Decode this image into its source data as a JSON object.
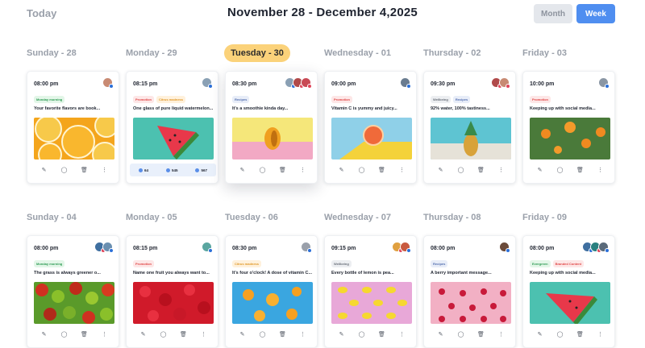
{
  "header": {
    "today_label": "Today",
    "range_label": "November 28 - December 4,2025",
    "view_month": "Month",
    "view_week": "Week"
  },
  "colors": {
    "accent": "#4f8ef0",
    "active_day": "#fbd27a"
  },
  "weeks": [
    {
      "days": [
        {
          "label": "Sunday - 28",
          "active": false,
          "card": {
            "time": "08:00 pm",
            "avatars": [
              {
                "bg": "#c88a73",
                "net": "#2b6fd8"
              }
            ],
            "tags": [
              {
                "text": "Monday morning",
                "bg": "#e3f6e8",
                "fg": "#2e9b54"
              }
            ],
            "text": "Your favorite flavors are book...",
            "image": "orange",
            "stats": null
          }
        },
        {
          "label": "Monday - 29",
          "active": false,
          "card": {
            "time": "08:15 pm",
            "avatars": [
              {
                "bg": "#8aa0b4",
                "net": "#2b6fd8"
              }
            ],
            "tags": [
              {
                "text": "Promotion",
                "bg": "#fde7e7",
                "fg": "#e04848"
              },
              {
                "text": "Citrus madness",
                "bg": "#fff1dc",
                "fg": "#e09a2c"
              }
            ],
            "text": "One glass of pure liquid watermelon...",
            "image": "watermelon",
            "stats": {
              "likes": "64",
              "shares": "545",
              "comments": "567"
            }
          }
        },
        {
          "label": "Tuesday - 30",
          "active": true,
          "card": {
            "time": "08:30 pm",
            "avatars": [
              {
                "bg": "#8aa0b4",
                "net": "#2b6fd8"
              },
              {
                "bg": "#b04a4a",
                "net": "#e0455a"
              },
              {
                "bg": "#c84a55",
                "net": "#e0455a"
              }
            ],
            "tags": [
              {
                "text": "Recipes",
                "bg": "#e8edf8",
                "fg": "#5570b0"
              }
            ],
            "text": "It's a smoothie kinda day...",
            "image": "mango",
            "stats": null
          }
        },
        {
          "label": "Wednesday - 01",
          "active": false,
          "card": {
            "time": "09:00 pm",
            "avatars": [
              {
                "bg": "#6a7c90",
                "net": "#2b6fd8"
              }
            ],
            "tags": [
              {
                "text": "Promotion",
                "bg": "#fde7e7",
                "fg": "#e04848"
              }
            ],
            "text": "Vitamin C is yummy and juicy...",
            "image": "grapefruit",
            "stats": null
          }
        },
        {
          "label": "Thursday - 02",
          "active": false,
          "card": {
            "time": "09:30 pm",
            "avatars": [
              {
                "bg": "#b04a4a",
                "net": "#e0455a"
              },
              {
                "bg": "#c88a73",
                "net": "#e0455a"
              }
            ],
            "tags": [
              {
                "text": "Wellbeing",
                "bg": "#eceef1",
                "fg": "#6a707a"
              },
              {
                "text": "Recipes",
                "bg": "#e8edf8",
                "fg": "#5570b0"
              }
            ],
            "text": "92% water, 100% tastiness...",
            "image": "pineapple",
            "stats": null
          }
        },
        {
          "label": "Friday - 03",
          "active": false,
          "card": {
            "time": "10:00 pm",
            "avatars": [
              {
                "bg": "#8a96a4",
                "net": "#2b6fd8"
              }
            ],
            "tags": [
              {
                "text": "Promotion",
                "bg": "#fde7e7",
                "fg": "#e04848"
              }
            ],
            "text": "Keeping up with social media...",
            "image": "orangetree",
            "stats": null
          }
        }
      ]
    },
    {
      "days": [
        {
          "label": "Sunday - 04",
          "active": false,
          "card": {
            "time": "08:00 pm",
            "avatars": [
              {
                "bg": "#3f6fa0",
                "net": "#e0455a"
              },
              {
                "bg": "#6a8fb0",
                "net": "#2b6fd8"
              }
            ],
            "tags": [
              {
                "text": "Monday morning",
                "bg": "#e3f6e8",
                "fg": "#2e9b54"
              }
            ],
            "text": "The grass is always greener o...",
            "image": "apples",
            "stats": null
          }
        },
        {
          "label": "Monday - 05",
          "active": false,
          "card": {
            "time": "08:15 pm",
            "avatars": [
              {
                "bg": "#5aa6a0",
                "net": "#2b6fd8"
              }
            ],
            "tags": [
              {
                "text": "Promotion",
                "bg": "#fde7e7",
                "fg": "#e04848"
              }
            ],
            "text": "Name one fruit you always want to...",
            "image": "strawberries",
            "stats": null
          }
        },
        {
          "label": "Tuesday - 06",
          "active": false,
          "card": {
            "time": "08:30 pm",
            "avatars": [
              {
                "bg": "#9aa0aa",
                "net": "#2b6fd8"
              }
            ],
            "tags": [
              {
                "text": "Citrus madness",
                "bg": "#fff1dc",
                "fg": "#e09a2c"
              }
            ],
            "text": "It's four o'clock! A dose of vitamin C...",
            "image": "oranges-blue",
            "stats": null
          }
        },
        {
          "label": "Wednesday - 07",
          "active": false,
          "card": {
            "time": "09:15 pm",
            "avatars": [
              {
                "bg": "#e0a040",
                "net": "#e0455a"
              },
              {
                "bg": "#c85a40",
                "net": "#2b6fd8"
              }
            ],
            "tags": [
              {
                "text": "Wellbeing",
                "bg": "#eceef1",
                "fg": "#6a707a"
              }
            ],
            "text": "Every bottle of lemon is pea...",
            "image": "lemons",
            "stats": null
          }
        },
        {
          "label": "Thursday - 08",
          "active": false,
          "card": {
            "time": "08:00 pm",
            "avatars": [
              {
                "bg": "#6a4a3a",
                "net": "#2b6fd8"
              }
            ],
            "tags": [
              {
                "text": "Recipes",
                "bg": "#e8edf8",
                "fg": "#5570b0"
              }
            ],
            "text": "A berry important message...",
            "image": "berries",
            "stats": null
          }
        },
        {
          "label": "Friday - 09",
          "active": false,
          "card": {
            "time": "08:00 pm",
            "avatars": [
              {
                "bg": "#3f6fa0",
                "net": "#2b6fd8"
              },
              {
                "bg": "#2a8080",
                "net": "#e0455a"
              },
              {
                "bg": "#5a6a7a",
                "net": "#2b6fd8"
              }
            ],
            "tags": [
              {
                "text": "Evergreen",
                "bg": "#e3f6e8",
                "fg": "#2e9b54"
              },
              {
                "text": "Branded Content",
                "bg": "#fde7e7",
                "fg": "#e04848"
              }
            ],
            "text": "Keeping up with social media...",
            "image": "watermelon2",
            "stats": null
          }
        }
      ]
    }
  ]
}
